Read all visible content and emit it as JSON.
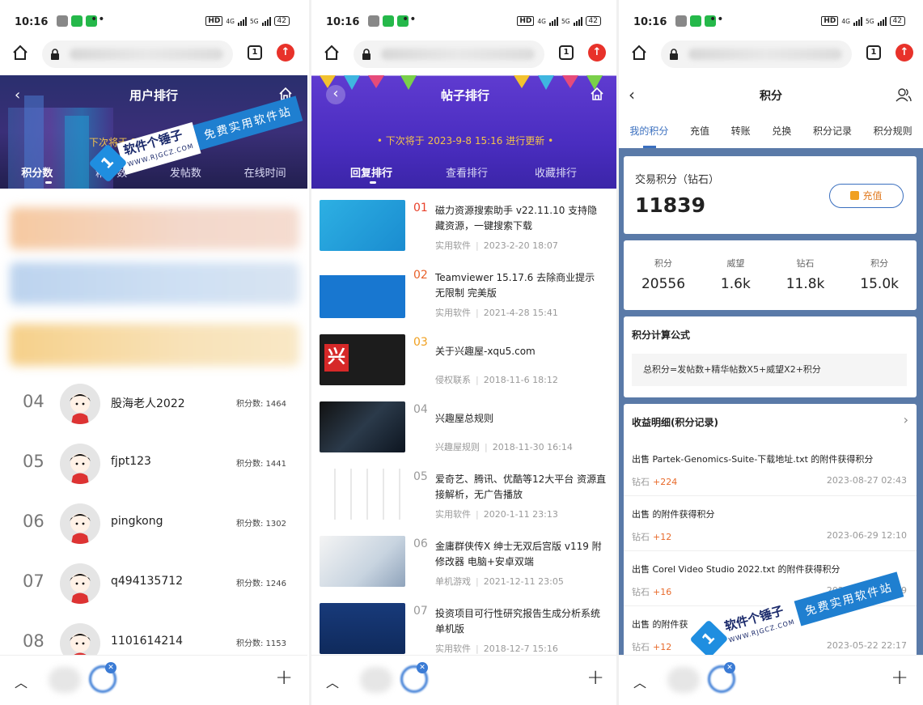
{
  "status_bar": {
    "time": "10:16",
    "battery": "42",
    "net_hd": "HD",
    "net_4g": "4G",
    "net_5g": "5G",
    "dots": "••"
  },
  "browser": {
    "tab_count": "1"
  },
  "panel1": {
    "title": "用户排行",
    "notice": "下次将于 2023",
    "tabs": [
      "积分数",
      "精华数",
      "发帖数",
      "在线时间"
    ],
    "rankings": [
      {
        "rank": "04",
        "name": "股海老人2022",
        "score": "积分数: 1464"
      },
      {
        "rank": "05",
        "name": "fjpt123",
        "score": "积分数: 1441"
      },
      {
        "rank": "06",
        "name": "pingkong",
        "score": "积分数: 1302"
      },
      {
        "rank": "07",
        "name": "q494135712",
        "score": "积分数: 1246"
      },
      {
        "rank": "08",
        "name": "1101614214",
        "score": "积分数: 1153"
      }
    ]
  },
  "panel2": {
    "title": "帖子排行",
    "notice": "下次将于 2023-9-8 15:16 进行更新",
    "tabs": [
      "回复排行",
      "查看排行",
      "收藏排行"
    ],
    "posts": [
      {
        "num": "01",
        "title": "磁力资源搜索助手 v22.11.10 支持隐藏资源，一键搜索下载",
        "category": "实用软件",
        "date": "2023-2-20 18:07",
        "color": "#e8402a"
      },
      {
        "num": "02",
        "title": "Teamviewer 15.17.6 去除商业提示 无限制 完美版",
        "category": "实用软件",
        "date": "2021-4-28 15:41",
        "color": "#e8602a"
      },
      {
        "num": "03",
        "title": "关于兴趣屋-xqu5.com",
        "category": "侵权联系",
        "date": "2018-11-6 18:12",
        "color": "#f0a020"
      },
      {
        "num": "04",
        "title": "兴趣屋总规则",
        "category": "兴趣屋规则",
        "date": "2018-11-30 16:14",
        "color": "#999999"
      },
      {
        "num": "05",
        "title": "爱奇艺、腾讯、优酷等12大平台 资源直接解析，无广告播放",
        "category": "实用软件",
        "date": "2020-1-11 23:13",
        "color": "#999999"
      },
      {
        "num": "06",
        "title": "金庸群侠传X 绅士无双后宫版 v119 附修改器 电脑+安卓双端",
        "category": "单机游戏",
        "date": "2021-12-11 23:05",
        "color": "#999999"
      },
      {
        "num": "07",
        "title": "投资项目可行性研究报告生成分析系统单机版",
        "category": "实用软件",
        "date": "2018-12-7 15:16",
        "color": "#999999"
      }
    ]
  },
  "panel3": {
    "title": "积分",
    "tabs": [
      "我的积分",
      "充值",
      "转账",
      "兑换",
      "积分记录",
      "积分规则"
    ],
    "trade_label": "交易积分（钻石）",
    "trade_value": "11839",
    "recharge_label": "充值",
    "stats": [
      {
        "label": "积分",
        "value": "20556"
      },
      {
        "label": "威望",
        "value": "1.6k"
      },
      {
        "label": "钻石",
        "value": "11.8k"
      },
      {
        "label": "积分",
        "value": "15.0k"
      }
    ],
    "formula_title": "积分计算公式",
    "formula": "总积分=发帖数+精华帖数X5+威望X2+积分",
    "income_title": "收益明细(积分记录)",
    "income": [
      {
        "title": "出售 Partek-Genomics-Suite-下载地址.txt 的附件获得积分",
        "kind": "钻石",
        "delta": "+224",
        "date": "2023-08-27 02:43"
      },
      {
        "title": "出售 的附件获得积分",
        "kind": "钻石",
        "delta": "+12",
        "date": "2023-06-29 12:10"
      },
      {
        "title": "出售 Corel Video Studio 2022.txt 的附件获得积分",
        "kind": "钻石",
        "delta": "+16",
        "date": "2023-06-18 22:09"
      },
      {
        "title": "出售 的附件获",
        "kind": "钻石",
        "delta": "+12",
        "date": "2023-05-22 22:17"
      }
    ]
  },
  "watermark": {
    "brand": "软件个锤子",
    "url": "WWW.RJGCZ.COM",
    "slogan": "免费实用软件站"
  }
}
